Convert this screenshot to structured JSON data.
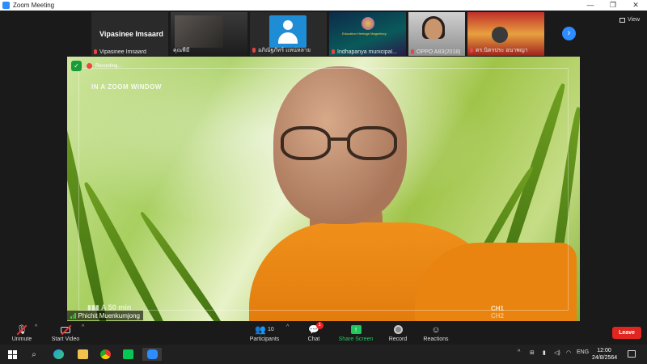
{
  "window": {
    "title": "Zoom Meeting",
    "controls": [
      "—",
      "❐",
      "✕"
    ]
  },
  "thumbnails": [
    {
      "big_name": "Vipasinee Imsaard",
      "name": "Vipasinee Imsaard",
      "muted": true
    },
    {
      "name": "คุณพีมี",
      "muted": false
    },
    {
      "name": "อภิณัฐภัทร์ แหน่หลาย",
      "muted": true
    },
    {
      "name": "Indhapanya municipal...",
      "muted": true,
      "banner": "Education Heritage Magnetecy"
    },
    {
      "name": "OPPO A83(2018)",
      "muted": true
    },
    {
      "name": "ดร.นิตรประ อนาพญา",
      "muted": true
    }
  ],
  "view_label": "View",
  "video": {
    "recording_label": "Recording...",
    "overlay_text": "IN A ZOOM WINDOW",
    "hud_left": "▮▮▮ A  50 min",
    "hud_right_1": "CH1",
    "hud_right_2": "CH2",
    "speaker_name": "Phichit Muenkumjong"
  },
  "toolbar": {
    "unmute": "Unmute",
    "start_video": "Start Video",
    "participants": "Participants",
    "participants_count": "10",
    "chat": "Chat",
    "chat_badge": "1",
    "share_screen": "Share Screen",
    "record": "Record",
    "reactions": "Reactions",
    "leave": "Leave"
  },
  "taskbar": {
    "tray_lang": "ENG",
    "time": "12:00",
    "date": "24/8/2564"
  },
  "colors": {
    "zoom_blue": "#2d8cff",
    "share_green": "#23c55e",
    "leave_red": "#e0261f",
    "robe_orange": "#f0901a"
  }
}
